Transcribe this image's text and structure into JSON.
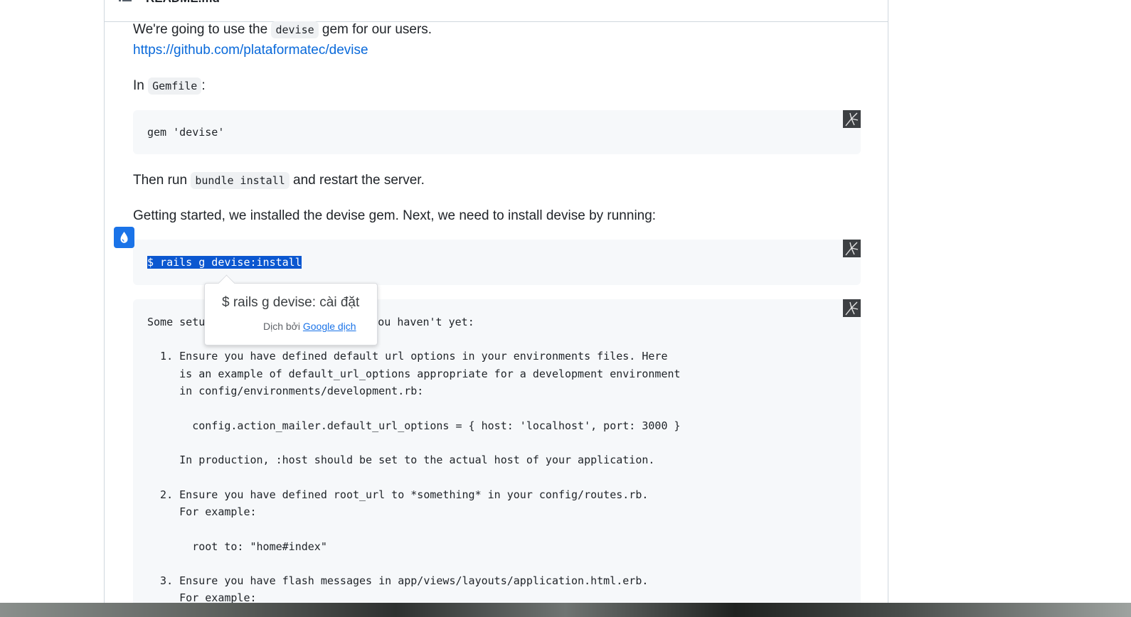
{
  "readme": {
    "filename": "README.md",
    "intro": {
      "before": "We're going to use the ",
      "code": "devise",
      "after": " gem for our users."
    },
    "link": "https://github.com/plataformatec/devise",
    "gemfile_line": {
      "before": "In ",
      "code": "Gemfile",
      "after": ":"
    },
    "code_gem": "gem 'devise'",
    "bundle_line": {
      "before": "Then run ",
      "code": "bundle install",
      "after": " and restart the server."
    },
    "getting_started": "Getting started, we installed the devise gem. Next, we need to install devise by running:",
    "code_install": "$ rails g devise:install",
    "output_lines": {
      "l0a": "Some setu",
      "l0b": "ou haven't yet:",
      "l1": "  1. Ensure you have defined default url options in your environments files. Here",
      "l2": "     is an example of default_url_options appropriate for a development environment",
      "l3": "     in config/environments/development.rb:",
      "l4": "       config.action_mailer.default_url_options = { host: 'localhost', port: 3000 }",
      "l5": "     In production, :host should be set to the actual host of your application.",
      "l6": "  2. Ensure you have defined root_url to *something* in your config/routes.rb.",
      "l7": "     For example:",
      "l8": "       root to: \"home#index\"",
      "l9": "  3. Ensure you have flash messages in app/views/layouts/application.html.erb.",
      "l10": "     For example:"
    }
  },
  "translate_popup": {
    "translation": "$ rails g devise: cài đặt",
    "attribution_prefix": "Dịch bởi ",
    "attribution_service": "Google dịch"
  },
  "icons": {
    "list": "list-icon",
    "copy": "copy-icon",
    "translate": "water-drop-icon"
  },
  "colors": {
    "link": "#0969da",
    "selection": "#0b57d0",
    "code_bg": "#f6f8fa",
    "translate_button": "#1a73e8"
  }
}
